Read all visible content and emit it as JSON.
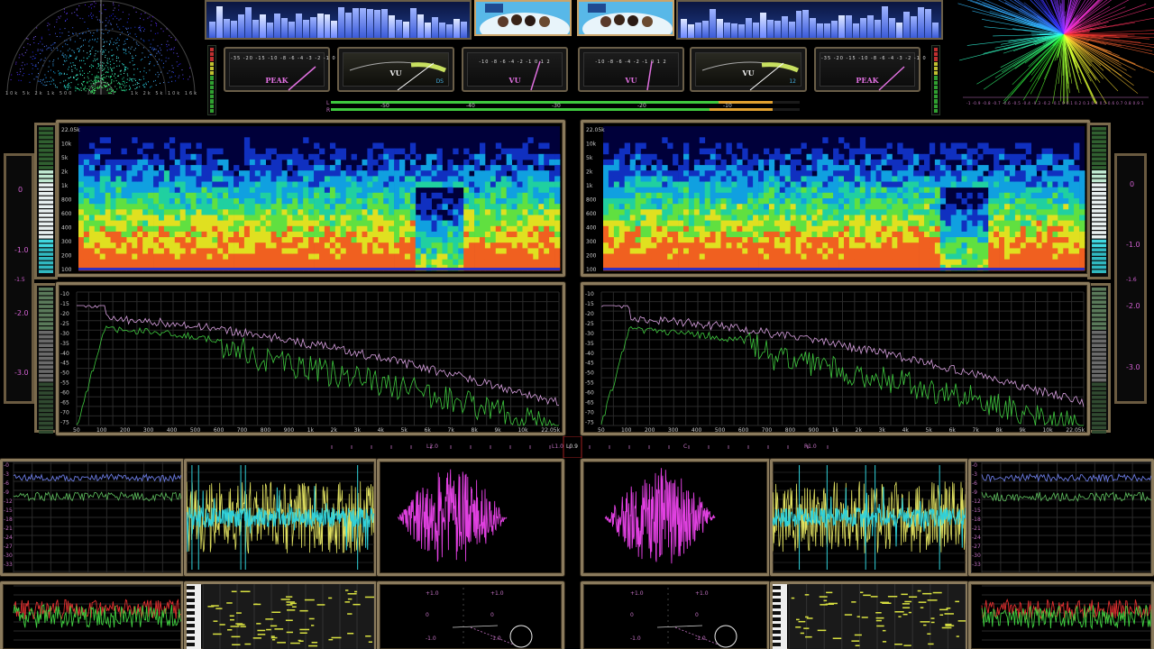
{
  "vu_meters": {
    "peak_label": "PEAK",
    "vu_label": "VU",
    "peak_scale": "-35 -20 -15 -10 -8 -6 -4 -3 -2 -1 0",
    "vu_scale": "-20 -10 -7 -5 -3 -1 0 1 2 3",
    "scale_short": "-10 -8 -6 -4 -2 -1 0 1 2",
    "tag_ds": "DS",
    "tag_12": "12"
  },
  "polar": {
    "left_ticks": "10k 5k 2k 1k 500",
    "right_ticks": "1k 2k 5k 10k 16k"
  },
  "meter_strip": {
    "ticks": [
      "-50",
      "-40",
      "-30",
      "-20",
      "-10",
      "0"
    ],
    "l": "L",
    "r": "R"
  },
  "phase_scale": "-1 -0.9 -0.8 -0.7 -0.6 -0.5 -0.4 -0.3 -0.2 -0.1 0 0.1 0.2 0.3 0.4 0.5 0.6 0.7 0.8 0.9 1",
  "spectrogram": {
    "freq_labels": [
      "22.05k",
      "10k",
      "5k",
      "2k",
      "1k",
      "800",
      "600",
      "400",
      "300",
      "200",
      "100"
    ]
  },
  "spectrum": {
    "db_labels": [
      "-10",
      "-15",
      "-20",
      "-25",
      "-30",
      "-35",
      "-40",
      "-45",
      "-50",
      "-55",
      "-60",
      "-65",
      "-70",
      "-75"
    ],
    "freq_ticks": [
      "50",
      "100",
      "200",
      "300",
      "400",
      "500",
      "600",
      "700",
      "800",
      "900",
      "1k",
      "2k",
      "3k",
      "4k",
      "5k",
      "6k",
      "7k",
      "8k",
      "9k",
      "10k",
      "22.05k"
    ]
  },
  "side_levels": {
    "left_marks": [
      "0",
      "-1.0",
      "-1.5",
      "-2.0",
      "-3.0"
    ],
    "right_marks": [
      "0",
      "-1.0",
      "-1.6",
      "-2.0",
      "-3.0"
    ]
  },
  "balance": {
    "labels": [
      "L2.0",
      "L1.0",
      "L0.9",
      "C",
      "R1.0"
    ]
  },
  "goniometer": {
    "plus": "+1.0",
    "zero": "0",
    "minus": "-1.0"
  },
  "colors": {
    "frame": "#8a7a5c",
    "accent": "#d060d0",
    "spectrum_green": "#3ec83e",
    "spectrum_pink": "#d8a0e0",
    "wave_cyan": "#30d0d8",
    "wave_yellow": "#e0e060",
    "vu_blue": "#3a5ad8"
  }
}
